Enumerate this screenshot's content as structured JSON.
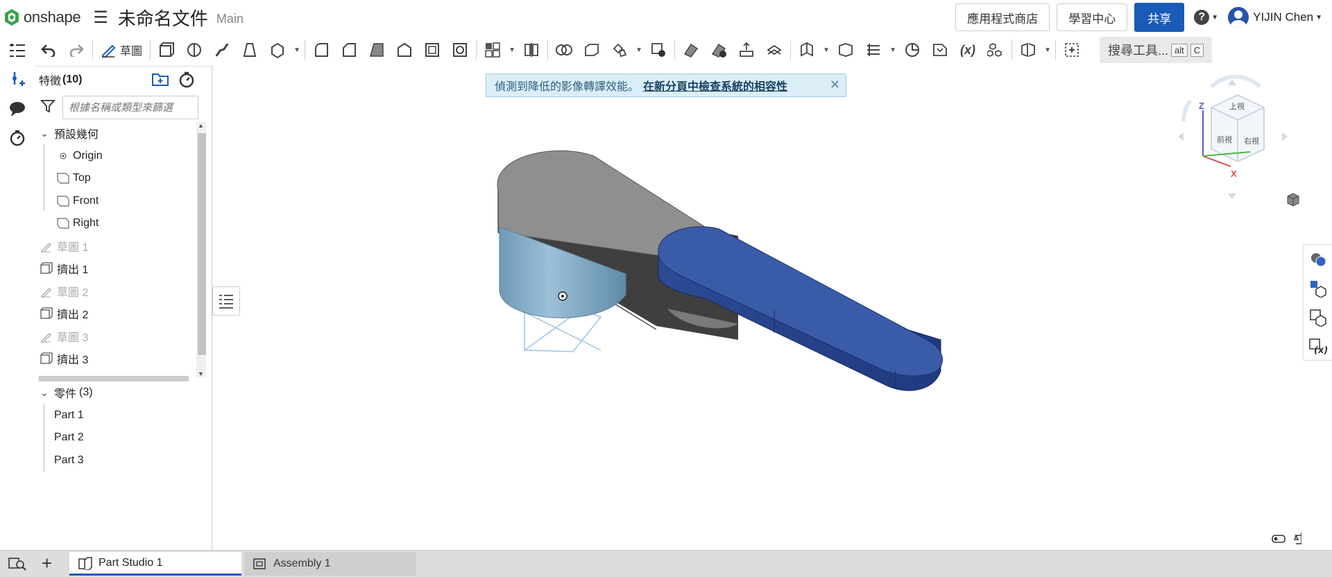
{
  "app": {
    "logo_text": "onshape",
    "doc_title": "未命名文件",
    "branch": "Main"
  },
  "header": {
    "app_store": "應用程式商店",
    "learning": "學習中心",
    "share": "共享",
    "user": "YIJIN Chen"
  },
  "toolbar": {
    "sketch_label": "草圖",
    "search_tools": "搜尋工具...",
    "kbd_alt": "alt",
    "kbd_c": "C"
  },
  "features": {
    "header": "特徵",
    "count": "(10)",
    "filter_placeholder": "根據名稱或類型來篩選",
    "default_geometry": "預設幾何",
    "items": [
      {
        "label": "Origin"
      },
      {
        "label": "Top"
      },
      {
        "label": "Front"
      },
      {
        "label": "Right"
      },
      {
        "label": "草圖 1"
      },
      {
        "label": "擠出 1"
      },
      {
        "label": "草圖 2"
      },
      {
        "label": "擠出 2"
      },
      {
        "label": "草圖 3"
      },
      {
        "label": "擠出 3"
      }
    ]
  },
  "parts": {
    "header": "零件",
    "count": "(3)",
    "items": [
      {
        "label": "Part 1"
      },
      {
        "label": "Part 2"
      },
      {
        "label": "Part 3"
      }
    ]
  },
  "banner": {
    "text": "偵測到降低的影像轉譯效能。",
    "link": "在新分頁中檢查系統的相容性"
  },
  "view_cube": {
    "top": "上視",
    "front": "前視",
    "right": "右視",
    "axis_z": "Z",
    "axis_x": "X"
  },
  "tabs": [
    {
      "label": "Part Studio 1"
    },
    {
      "label": "Assembly 1"
    }
  ],
  "colors": {
    "accent": "#1a5bb8",
    "part_blue": "#3a5ca8",
    "part_gray": "#8e8e8e"
  }
}
